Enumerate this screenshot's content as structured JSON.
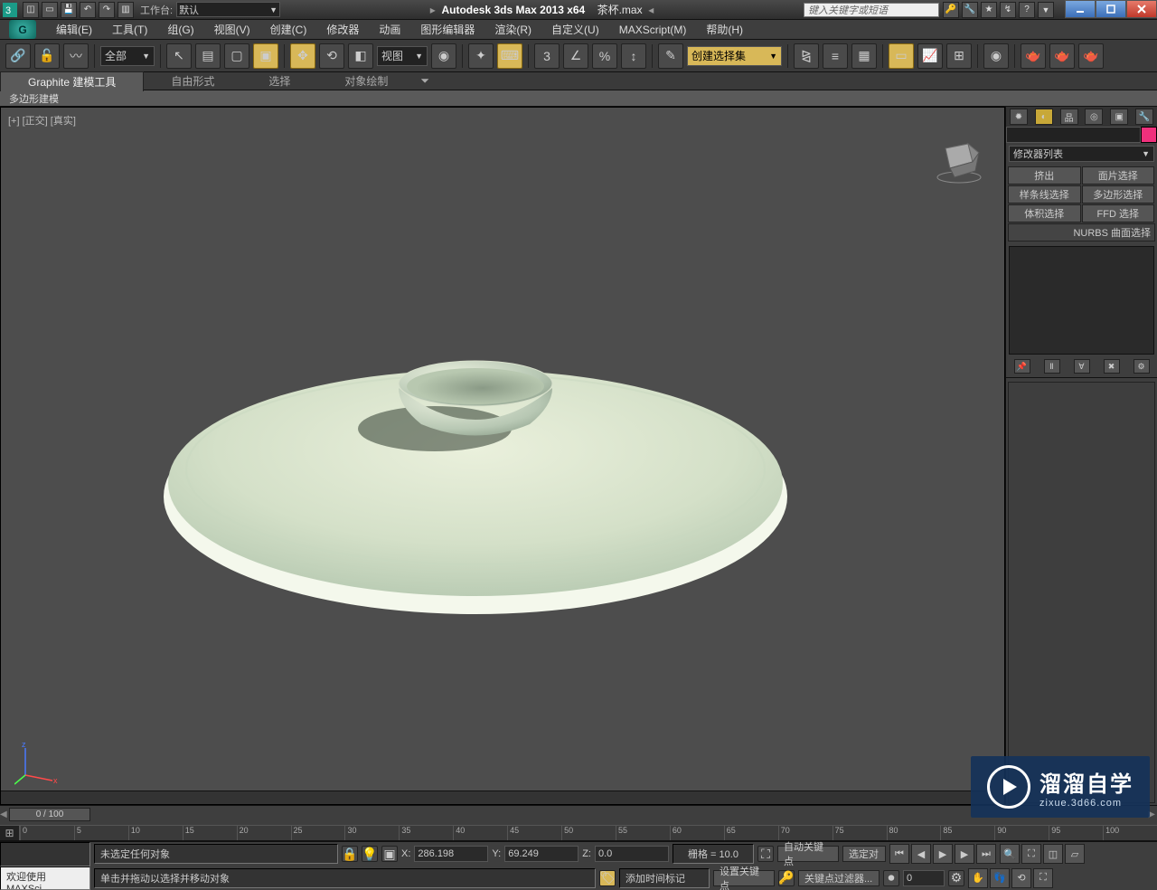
{
  "title": {
    "app": "Autodesk 3ds Max  2013 x64",
    "doc": "茶杯.max",
    "workspace_label": "工作台:",
    "workspace_value": "默认",
    "search_placeholder": "键入关键字或短语"
  },
  "menu": [
    "编辑(E)",
    "工具(T)",
    "组(G)",
    "视图(V)",
    "创建(C)",
    "修改器",
    "动画",
    "图形编辑器",
    "渲染(R)",
    "自定义(U)",
    "MAXScript(M)",
    "帮助(H)"
  ],
  "toolbar": {
    "filter_all": "全部",
    "view_drop": "视图",
    "selset_drop": "创建选择集"
  },
  "ribbon": {
    "tabs": [
      "Graphite 建模工具",
      "自由形式",
      "选择",
      "对象绘制"
    ],
    "sub": "多边形建模"
  },
  "viewport": {
    "label": "[+] [正交] [真实]"
  },
  "command_panel": {
    "modifier_list": "修改器列表",
    "mod_buttons": [
      "挤出",
      "面片选择",
      "样条线选择",
      "多边形选择",
      "体积选择",
      "FFD 选择"
    ],
    "nurbs": "NURBS 曲面选择"
  },
  "timeline": {
    "slider": "0 / 100",
    "ticks": [
      "0",
      "5",
      "10",
      "15",
      "20",
      "25",
      "30",
      "35",
      "40",
      "45",
      "50",
      "55",
      "60",
      "65",
      "70",
      "75",
      "80",
      "85",
      "90",
      "95",
      "100"
    ]
  },
  "status": {
    "left1": "",
    "left2": "欢迎使用  MAXSci",
    "sel": "未选定任何对象",
    "prompt": "单击并拖动以选择并移动对象",
    "x_label": "X:",
    "x": "286.198",
    "y_label": "Y:",
    "y": "69.249",
    "z_label": "Z:",
    "z": "0.0",
    "grid": "栅格 = 10.0",
    "timetag": "添加时间标记",
    "auto_key": "自动关键点",
    "set_key": "设置关键点",
    "selected_btn": "选定对",
    "keyfilter": "关键点过滤器...",
    "frame": "0"
  },
  "watermark": {
    "big": "溜溜自学",
    "small": "zixue.3d66.com"
  }
}
